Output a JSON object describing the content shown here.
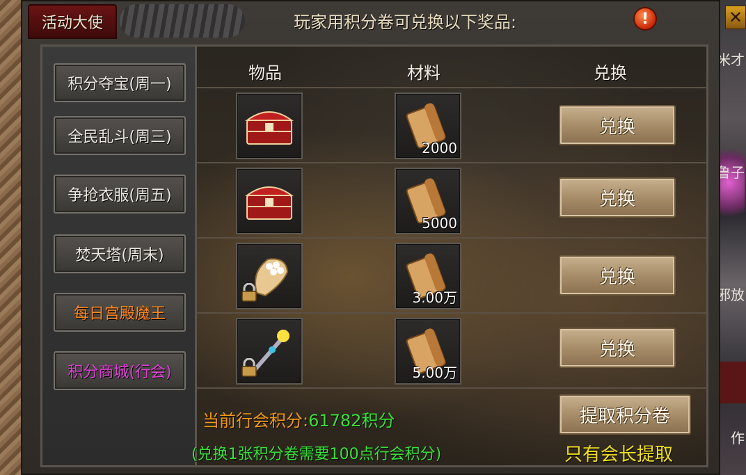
{
  "window": {
    "title": "活动大使",
    "heading": "玩家用积分卷可兑换以下奖品:",
    "alert_symbol": "!"
  },
  "sidebar": {
    "items": [
      {
        "label": "积分夺宝(周一)",
        "color": "#ece8e0"
      },
      {
        "label": "全民乱斗(周三)",
        "color": "#ece8e0"
      },
      {
        "label": "争抢衣服(周五)",
        "color": "#ece8e0"
      },
      {
        "label": "焚天塔(周末)",
        "color": "#ece8e0"
      },
      {
        "label": "每日宫殿魔王",
        "color": "#ff8a22"
      },
      {
        "label": "积分商城(行会)",
        "color": "#e040d8"
      }
    ]
  },
  "table": {
    "headers": {
      "item": "物品",
      "material": "材料",
      "exchange": "兑换"
    },
    "rows": [
      {
        "item_icon": "red-treasure-chest-icon",
        "locked": false,
        "material_icon": "scroll-icon",
        "material_qty": "2000",
        "button": "兑换"
      },
      {
        "item_icon": "red-treasure-chest-icon",
        "locked": false,
        "material_icon": "scroll-icon",
        "material_qty": "5000",
        "button": "兑换"
      },
      {
        "item_icon": "pearl-glove-icon",
        "locked": true,
        "material_icon": "scroll-icon",
        "material_qty": "3.00万",
        "button": "兑换"
      },
      {
        "item_icon": "jeweled-wand-icon",
        "locked": true,
        "material_icon": "scroll-icon",
        "material_qty": "5.00万",
        "button": "兑换"
      }
    ]
  },
  "footer": {
    "points_label": "当前行会积分:",
    "points_value": "61782积分",
    "note": "(兑换1张积分卷需要100点行会积分)",
    "withdraw_button": "提取积分卷",
    "leader_note": "只有会长提取"
  },
  "background_right_text": [
    "米才",
    "鲁子",
    "邪放",
    "作"
  ],
  "colors": {
    "accent_orange": "#f09a1a",
    "accent_green": "#3ae03a",
    "accent_yellow": "#f0e020",
    "accent_magenta": "#e040d8"
  }
}
